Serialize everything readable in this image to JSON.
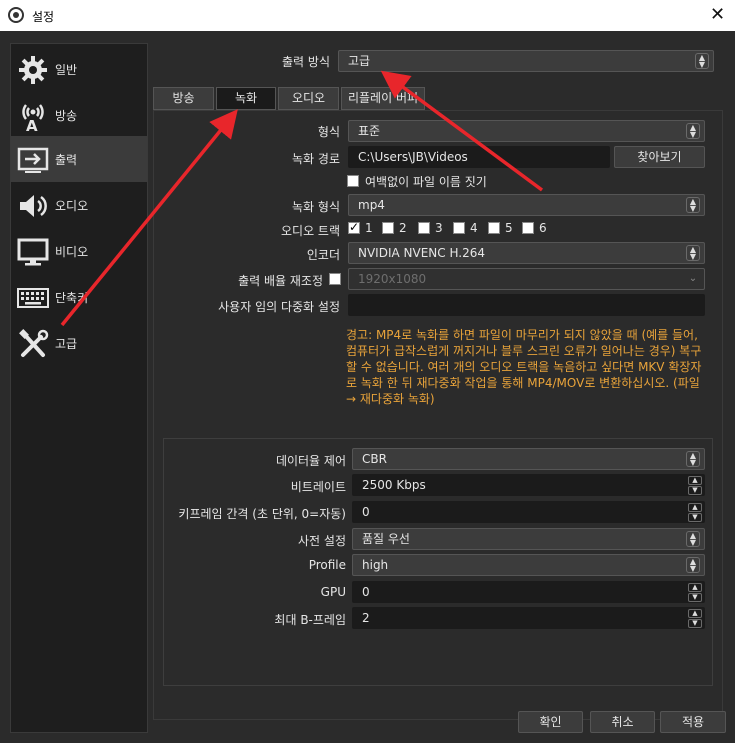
{
  "window": {
    "title": "설정",
    "close_glyph": "✕"
  },
  "sidebar": {
    "items": [
      {
        "label": "일반",
        "icon": "gear-icon"
      },
      {
        "label": "방송",
        "icon": "broadcast-icon"
      },
      {
        "label": "출력",
        "icon": "output-icon",
        "active": true
      },
      {
        "label": "오디오",
        "icon": "speaker-icon"
      },
      {
        "label": "비디오",
        "icon": "monitor-icon"
      },
      {
        "label": "단축키",
        "icon": "keyboard-icon"
      },
      {
        "label": "고급",
        "icon": "tools-icon"
      }
    ]
  },
  "output_mode": {
    "label": "출력 방식",
    "value": "고급"
  },
  "tabs": [
    {
      "label": "방송"
    },
    {
      "label": "녹화",
      "active": true
    },
    {
      "label": "오디오"
    },
    {
      "label": "리플레이 버퍼"
    }
  ],
  "recording": {
    "type_label": "형식",
    "type_value": "표준",
    "path_label": "녹화 경로",
    "path_value": "C:\\Users\\JB\\Videos",
    "browse_label": "찾아보기",
    "nospace_label": "여백없이 파일 이름 짓기",
    "format_label": "녹화 형식",
    "format_value": "mp4",
    "audio_track_label": "오디오 트랙",
    "tracks": [
      "1",
      "2",
      "3",
      "4",
      "5",
      "6"
    ],
    "track_checked": [
      true,
      false,
      false,
      false,
      false,
      false
    ],
    "encoder_label": "인코더",
    "encoder_value": "NVIDIA NVENC H.264",
    "rescale_label": "출력 배율 재조정",
    "rescale_value": "1920x1080",
    "custom_muxer_label": "사용자 임의 다중화 설정",
    "custom_muxer_value": "",
    "warning": "경고: MP4로 녹화를 하면 파일이 마무리가 되지 않았을 때 (예를 들어, 컴퓨터가 급작스럽게 꺼지거나 블루 스크린 오류가 일어나는 경우) 복구할 수 없습니다. 여러 개의 오디오 트랙을 녹음하고 싶다면 MKV 확장자로 녹화 한 뒤 재다중화 작업을 통해 MP4/MOV로 변환하십시오. (파일 → 재다중화 녹화)"
  },
  "encoder_settings": {
    "rate_control_label": "데이터율 제어",
    "rate_control_value": "CBR",
    "bitrate_label": "비트레이트",
    "bitrate_value": "2500 Kbps",
    "keyframe_label": "키프레임 간격 (초 단위, 0=자동)",
    "keyframe_value": "0",
    "preset_label": "사전 설정",
    "preset_value": "품질 우선",
    "profile_label": "Profile",
    "profile_value": "high",
    "gpu_label": "GPU",
    "gpu_value": "0",
    "bframes_label": "최대 B-프레임",
    "bframes_value": "2"
  },
  "buttons": {
    "ok": "확인",
    "cancel": "취소",
    "apply": "적용"
  },
  "colors": {
    "annotation_arrow": "#e8262b",
    "warning_text": "#e8a33a",
    "background": "#2b2b2b"
  }
}
